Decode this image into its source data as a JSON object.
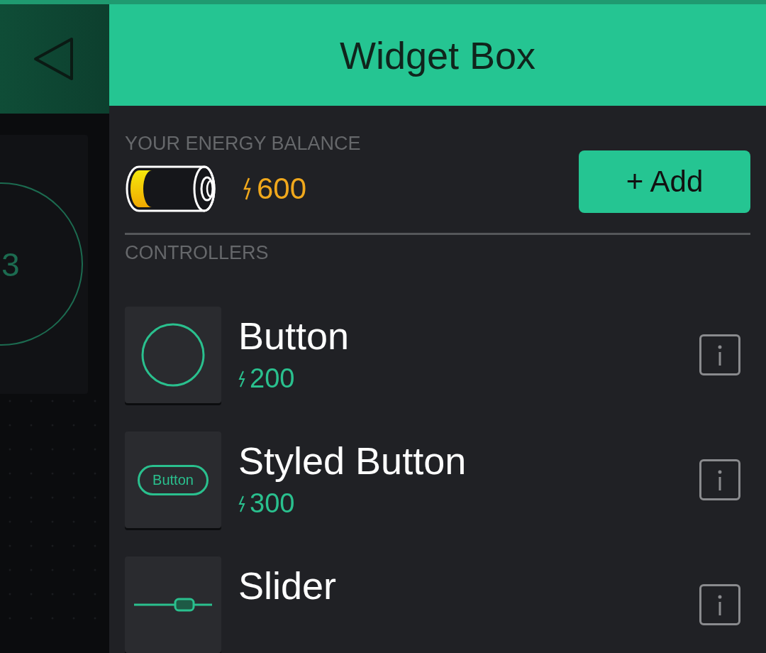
{
  "side_panel": {
    "widget_value": "3"
  },
  "header": {
    "title": "Widget Box"
  },
  "energy": {
    "label": "YOUR ENERGY BALANCE",
    "amount": "600",
    "add_button": "+ Add"
  },
  "section": {
    "title": "CONTROLLERS"
  },
  "widgets": [
    {
      "kind": "button",
      "name": "Button",
      "price": "200"
    },
    {
      "kind": "styled_button",
      "name": "Styled Button",
      "price": "300",
      "preview_label": "Button"
    },
    {
      "kind": "slider",
      "name": "Slider"
    }
  ]
}
